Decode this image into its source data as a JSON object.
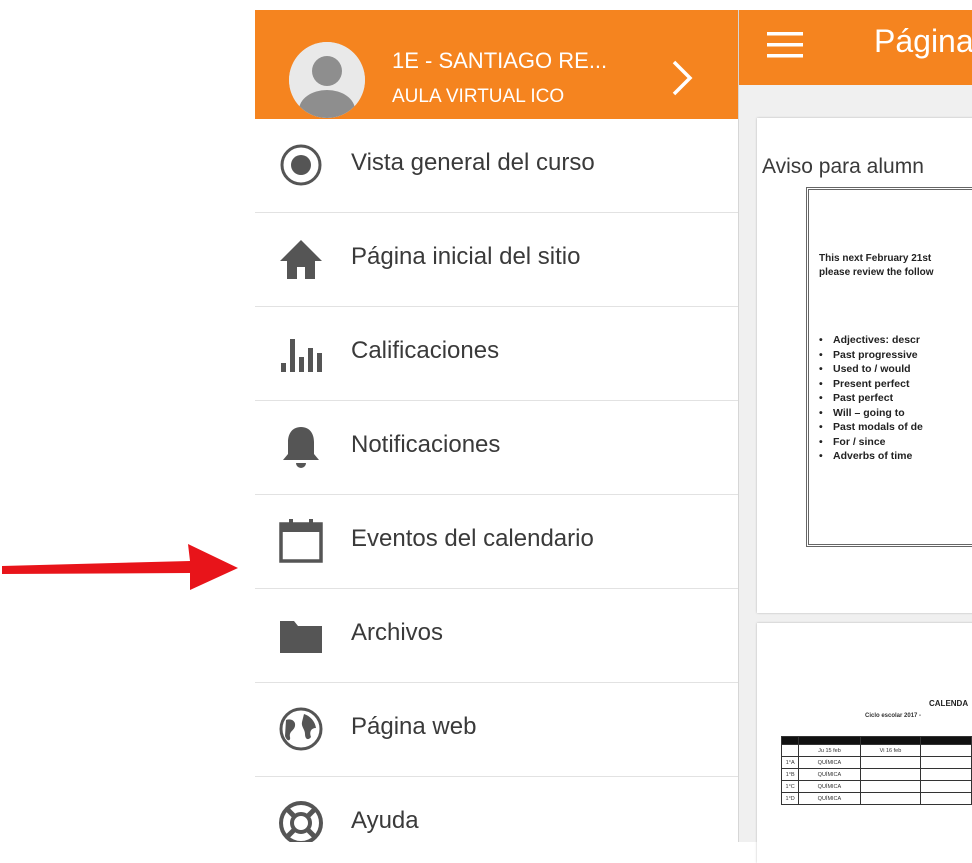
{
  "drawer": {
    "course_title": "1E - SANTIAGO RE...",
    "site_title": "AULA VIRTUAL ICO",
    "items": [
      {
        "label": "Vista general del curso",
        "icon": "course-overview-icon"
      },
      {
        "label": "Página inicial del sitio",
        "icon": "home-icon"
      },
      {
        "label": "Calificaciones",
        "icon": "grades-chart-icon"
      },
      {
        "label": "Notificaciones",
        "icon": "bell-icon"
      },
      {
        "label": "Eventos del calendario",
        "icon": "calendar-icon"
      },
      {
        "label": "Archivos",
        "icon": "folder-icon"
      },
      {
        "label": "Página web",
        "icon": "globe-icon"
      },
      {
        "label": "Ayuda",
        "icon": "lifebuoy-icon"
      }
    ]
  },
  "appbar": {
    "title": "Página"
  },
  "content": {
    "notice_label": "Aviso para alumn",
    "notice_intro": [
      "This next February 21st",
      "please review the follow"
    ],
    "topics": [
      "Adjectives: descr",
      "Past progressive",
      "Used to / would",
      "Present perfect",
      "Past perfect",
      "Will – going to",
      "Past modals of de",
      "For / since",
      "Adverbs of time"
    ],
    "calendar": {
      "title": "CALENDA",
      "subtitle": "Ciclo escolar 2017 -",
      "columns": [
        "",
        "Ju 15 feb",
        "Vi 16 feb",
        ""
      ],
      "rows": [
        {
          "group": "1°A",
          "subject": "QUÍMICA"
        },
        {
          "group": "1°B",
          "subject": "QUÍMICA"
        },
        {
          "group": "1°C",
          "subject": "QUÍMICA"
        },
        {
          "group": "1°D",
          "subject": "QUÍMICA"
        }
      ]
    }
  },
  "colors": {
    "accent": "#f5841f",
    "arrow": "#e8141a",
    "text": "#3a3a3a"
  }
}
